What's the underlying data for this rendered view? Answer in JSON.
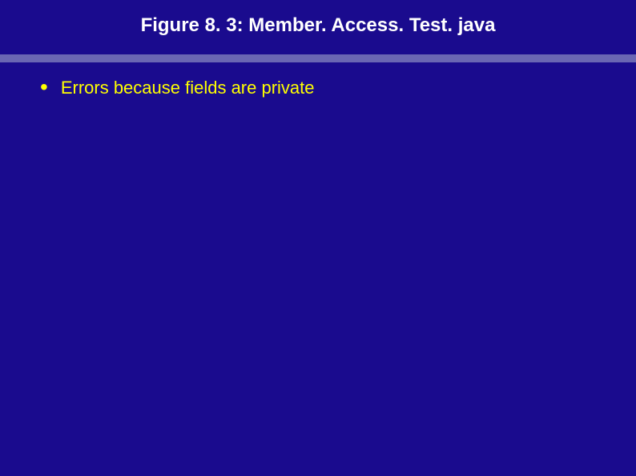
{
  "slide": {
    "title": "Figure 8. 3: Member. Access. Test. java",
    "bullets": [
      {
        "text": "Errors because fields are private"
      }
    ]
  }
}
